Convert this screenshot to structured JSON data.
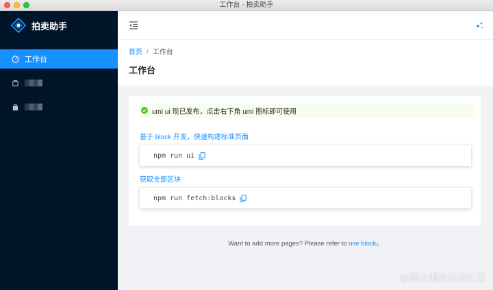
{
  "window": {
    "title": "工作台 - 拍卖助手"
  },
  "brand": {
    "name": "拍卖助手"
  },
  "sidebar": {
    "items": [
      {
        "label": "工作台",
        "icon": "dashboard-icon",
        "active": true
      },
      {
        "label": "",
        "icon": "auction-icon",
        "active": false
      },
      {
        "label": "",
        "icon": "shop-icon",
        "active": false
      }
    ]
  },
  "header": {
    "fold_icon": "menu-fold-icon",
    "right_icon": "umi-ui-icon"
  },
  "breadcrumb": {
    "home": "首页",
    "separator": "/",
    "current": "工作台"
  },
  "page": {
    "title": "工作台"
  },
  "alert": {
    "text": "umi ui 现已发布，点击右下角 umi 图标即可使用"
  },
  "sections": [
    {
      "title": "基于 block 开发，快速构建标准页面",
      "command": "npm run ui"
    },
    {
      "title": "获取全部区块",
      "command": "npm run fetch:blocks"
    }
  ],
  "footer": {
    "text": "Want to add more pages? Please refer to ",
    "link": "use block",
    "suffix": "。"
  },
  "watermark": {
    "text": "@稀土掘金技术社区"
  },
  "colors": {
    "primary": "#1890ff",
    "sidebar_bg": "#001529",
    "success": "#52c41a",
    "alert_bg": "#f6ffed"
  }
}
